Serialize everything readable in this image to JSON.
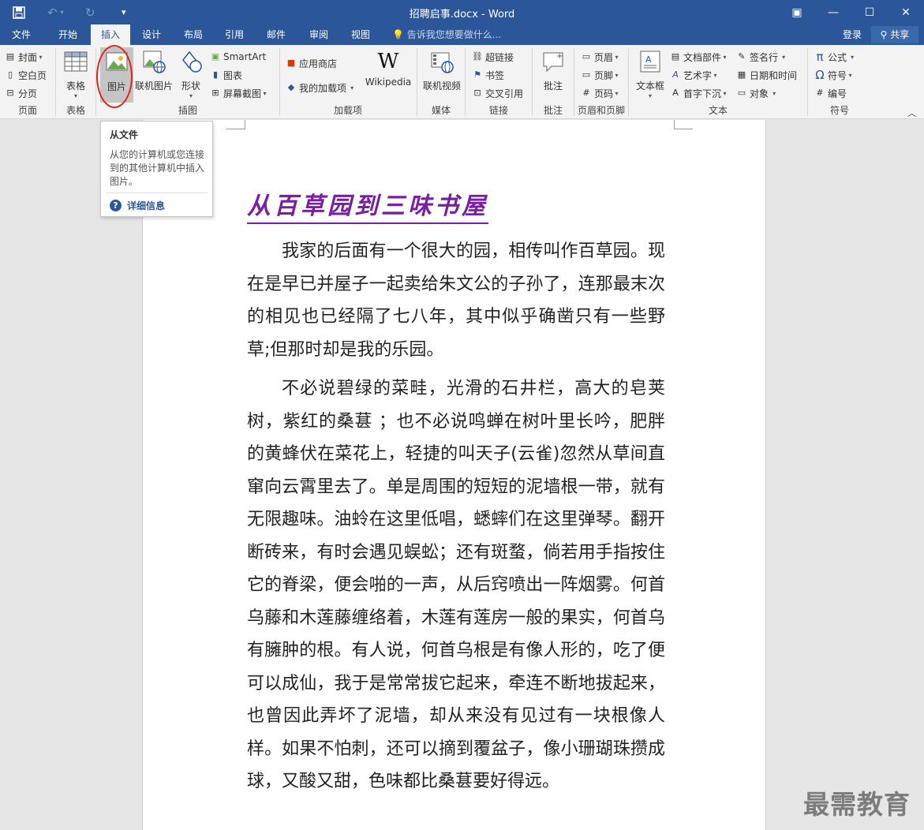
{
  "window": {
    "title": "招聘启事.docx - Word",
    "qat": {
      "save_icon": "save-icon",
      "undo_icon": "undo-icon",
      "redo_icon": "redo-icon",
      "customize_icon": "customize-qat-icon"
    },
    "controls": {
      "ribbon_display": "▣",
      "minimize": "—",
      "maximize": "☐",
      "close": "✕"
    }
  },
  "tabs": [
    "文件",
    "开始",
    "插入",
    "设计",
    "布局",
    "引用",
    "邮件",
    "审阅",
    "视图"
  ],
  "active_tab": "插入",
  "tellme": "告诉我您想要做什么...",
  "account": {
    "login": "登录",
    "share": "共享"
  },
  "ribbon": {
    "pages": {
      "label": "页面",
      "cover": "封面",
      "blank": "空白页",
      "break": "分页"
    },
    "tables": {
      "label": "表格",
      "table": "表格"
    },
    "illustrations": {
      "label": "插图",
      "picture": "图片",
      "online_picture": "联机图片",
      "shapes": "形状",
      "smartart": "SmartArt",
      "chart": "图表",
      "screenshot": "屏幕截图"
    },
    "addins": {
      "label": "加载项",
      "store": "应用商店",
      "my_addins": "我的加载项",
      "wikipedia": "Wikipedia"
    },
    "media": {
      "label": "媒体",
      "online_video": "联机视频"
    },
    "links": {
      "label": "链接",
      "hyperlink": "超链接",
      "bookmark": "书签",
      "crossref": "交叉引用"
    },
    "comments": {
      "label": "批注",
      "comment": "批注"
    },
    "header_footer": {
      "label": "页眉和页脚",
      "header": "页眉",
      "footer": "页脚",
      "page_number": "页码"
    },
    "text": {
      "label": "文本",
      "textbox": "文本框",
      "quick_parts": "文档部件",
      "wordart": "艺术字",
      "dropcap": "首字下沉",
      "signature": "签名行",
      "datetime": "日期和时间",
      "object": "对象"
    },
    "symbols": {
      "label": "符号",
      "equation": "公式",
      "symbol": "符号",
      "numbering": "编号"
    }
  },
  "tooltip": {
    "title": "从文件",
    "body": "从您的计算机或您连接到的其他计算机中插入图片。",
    "more": "详细信息"
  },
  "document": {
    "title": "从百草园到三味书屋",
    "paragraphs": [
      "我家的后面有一个很大的园，相传叫作百草园。现在是早已并屋子一起卖给朱文公的子孙了，连那最末次的相见也已经隔了七八年，其中似乎确凿只有一些野草;但那时却是我的乐园。",
      "不必说碧绿的菜畦，光滑的石井栏，高大的皂荚树，紫红的桑葚 ；也不必说鸣蝉在树叶里长吟，肥胖的黄蜂伏在菜花上，轻捷的叫天子(云雀)忽然从草间直窜向云霄里去了。单是周围的短短的泥墙根一带，就有无限趣味。油蛉在这里低唱，蟋蟀们在这里弹琴。翻开断砖来，有时会遇见蜈蚣；还有斑蝥，倘若用手指按住它的脊梁，便会啪的一声，从后窍喷出一阵烟雾。何首乌藤和木莲藤缠络着，木莲有莲房一般的果实，何首乌有臃肿的根。有人说，何首乌根是有像人形的，吃了便可以成仙，我于是常常拔它起来，牵连不断地拔起来，也曾因此弄坏了泥墙，却从来没有见过有一块根像人样。如果不怕刺，还可以摘到覆盆子，像小珊瑚珠攒成球，又酸又甜，色味都比桑葚要好得远。"
    ]
  },
  "watermark": "最需教育",
  "colors": {
    "brand": "#2b579a",
    "title_purple": "#7a1fa2",
    "highlight_circle": "#e2231a"
  }
}
